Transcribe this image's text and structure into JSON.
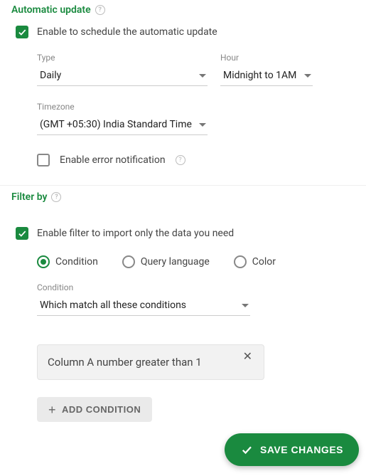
{
  "auto_update": {
    "title": "Automatic update",
    "enable_label": "Enable to schedule the automatic update",
    "type_label": "Type",
    "type_value": "Daily",
    "hour_label": "Hour",
    "hour_value": "Midnight to 1AM",
    "timezone_label": "Timezone",
    "timezone_value": "(GMT +05:30) India Standard Time",
    "error_notify_label": "Enable error notification"
  },
  "filter": {
    "title": "Filter by",
    "enable_label": "Enable filter to import only the data you need",
    "radio_condition": "Condition",
    "radio_query": "Query language",
    "radio_color": "Color",
    "condition_label": "Condition",
    "condition_value": "Which match all these conditions",
    "chip_text": "Column A number greater than 1",
    "add_button": "ADD CONDITION"
  },
  "save_button": "SAVE CHANGES"
}
